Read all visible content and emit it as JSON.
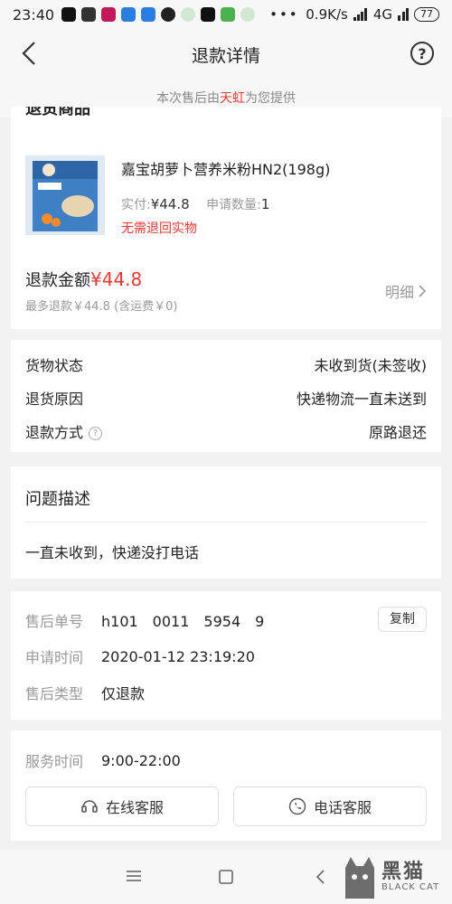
{
  "status_bar": {
    "time": "23:40",
    "network_speed": "0.9K/s",
    "network_type": "4G",
    "battery": "77"
  },
  "header": {
    "title": "退款详情",
    "help": "?"
  },
  "provider": {
    "prefix": "本次售后由",
    "brand": "天虹",
    "suffix": "为您提供"
  },
  "goods_section": {
    "title": "退货商品",
    "product_name": "嘉宝胡萝卜营养米粉HN2(198g)",
    "paid_label": "实付:",
    "paid_value": "¥44.8",
    "qty_label": "申请数量:",
    "qty_value": "1",
    "notice": "无需退回实物"
  },
  "refund": {
    "label": "退款金额",
    "amount": "¥44.8",
    "max_note": "最多退款￥44.8 (含运费￥0)",
    "detail_link": "明细"
  },
  "status": [
    {
      "label": "货物状态",
      "value": "未收到货(未签收)"
    },
    {
      "label": "退货原因",
      "value": "快递物流一直未送到"
    },
    {
      "label": "退款方式",
      "value": "原路退还"
    }
  ],
  "problem": {
    "title": "问题描述",
    "text": "一直未收到，快递没打电话"
  },
  "order": {
    "no_label": "售后单号",
    "no_value": "h101　0011　5954　9",
    "copy_label": "复制",
    "time_label": "申请时间",
    "time_value": "2020-01-12 23:19:20",
    "type_label": "售后类型",
    "type_value": "仅退款"
  },
  "service": {
    "time_label": "服务时间",
    "time_value": "9:00-22:00",
    "online_label": "在线客服",
    "phone_label": "电话客服"
  },
  "watermark": {
    "text": "黑猫",
    "sub": "BLACK CAT"
  }
}
